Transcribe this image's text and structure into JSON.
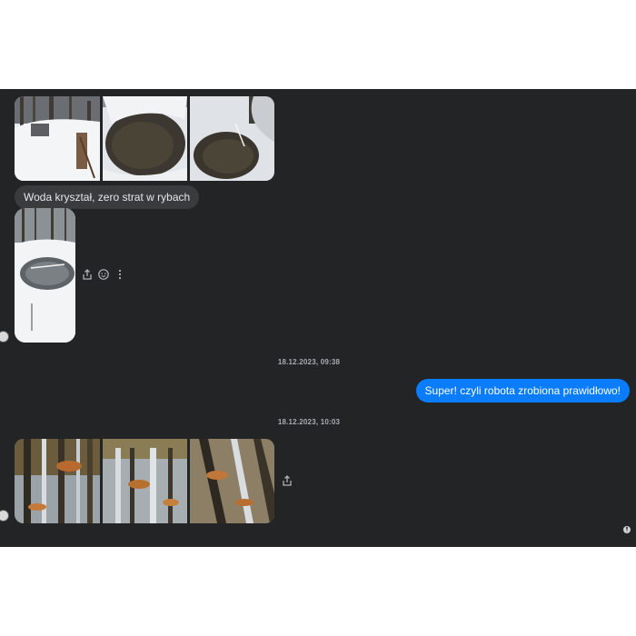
{
  "conversation": {
    "incoming_message": "Woda kryształ, zero strat w rybach",
    "outgoing_message": "Super! czyli robota zrobiona prawidłowo!",
    "timestamps": [
      "18.12.2023, 09:38",
      "18.12.2023, 10:03"
    ]
  },
  "photo_groups": [
    {
      "name": "snow-photos",
      "count": 3
    },
    {
      "name": "pond-photo-single",
      "count": 1
    },
    {
      "name": "reflection-photos",
      "count": 3
    }
  ],
  "icons": {
    "share": "share-icon",
    "react": "emoji-react-icon",
    "more": "more-options-icon",
    "seen": "seen-avatar-icon"
  },
  "colors": {
    "chat_background": "#232425",
    "incoming_bubble": "#3a3b3c",
    "outgoing_bubble": "#0a7cff",
    "timestamp_text": "#a8abaf"
  }
}
